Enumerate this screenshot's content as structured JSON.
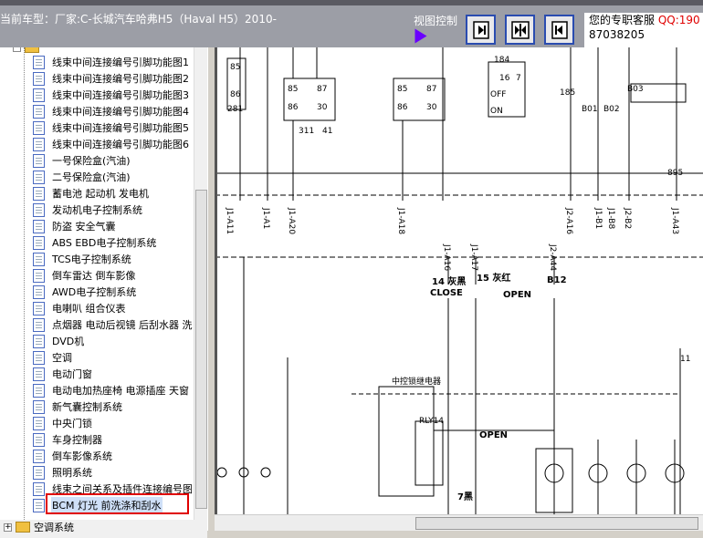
{
  "header": {
    "title": "当前车型：厂家:C-长城汽车哈弗H5（Haval H5）2010-",
    "view_control": "视图控制",
    "support_label": "您的专职客服",
    "qq_label": "QQ:190",
    "support_number": "87038205"
  },
  "tree": {
    "items": [
      {
        "label": "线束中间连接编号引脚功能图1"
      },
      {
        "label": "线束中间连接编号引脚功能图2"
      },
      {
        "label": "线束中间连接编号引脚功能图3"
      },
      {
        "label": "线束中间连接编号引脚功能图4"
      },
      {
        "label": "线束中间连接编号引脚功能图5"
      },
      {
        "label": "线束中间连接编号引脚功能图6"
      },
      {
        "label": "一号保险盒(汽油)"
      },
      {
        "label": "二号保险盒(汽油)"
      },
      {
        "label": "蓄电池 起动机 发电机"
      },
      {
        "label": "发动机电子控制系统"
      },
      {
        "label": "防盗 安全气囊"
      },
      {
        "label": "ABS EBD电子控制系统"
      },
      {
        "label": "TCS电子控制系统"
      },
      {
        "label": "倒车雷达 倒车影像"
      },
      {
        "label": "AWD电子控制系统"
      },
      {
        "label": "电喇叭 组合仪表"
      },
      {
        "label": "点烟器 电动后视镜 后刮水器 洗"
      },
      {
        "label": "DVD机"
      },
      {
        "label": "空调"
      },
      {
        "label": "电动门窗"
      },
      {
        "label": "电动电加热座椅 电源插座 天窗"
      },
      {
        "label": "新气囊控制系统"
      },
      {
        "label": "中央门锁"
      },
      {
        "label": "车身控制器"
      },
      {
        "label": "倒车影像系统"
      },
      {
        "label": "照明系统"
      },
      {
        "label": "线束之间关系及插件连接编号图"
      },
      {
        "label": "BCM 灯光 前洗涤和刮水"
      }
    ],
    "selected_index": 27,
    "bottom_folder": "空调系统"
  },
  "diagram": {
    "labels": {
      "relay1": "85",
      "relay1b": "86",
      "relay1c": "281",
      "r2_85": "85",
      "r2_87": "87",
      "r2_86": "86",
      "r2_30": "30",
      "r3_85": "85",
      "r3_87": "87",
      "r3_86": "86",
      "r3_30": "30",
      "w311": "311",
      "w41": "41",
      "sw_184": "184",
      "sw_16": "16",
      "sw_7": "7",
      "sw_off": "OFF",
      "sw_on": "ON",
      "sw_185": "185",
      "b01": "B01",
      "b02": "B02",
      "b03": "B03",
      "n895": "895",
      "c14": "14 灰黑",
      "close": "CLOSE",
      "c15": "15 灰红",
      "open": "OPEN",
      "b12": "B12",
      "central_lock": "中控锁继电器",
      "rly14": "RLY14",
      "open2": "OPEN",
      "n11": "11",
      "n7": "7黑",
      "j1a11": "J1-A11",
      "j1a1": "J1-A1",
      "j1a20": "J1-A20",
      "j1a18": "J1-A18",
      "j2a16": "J2-A16",
      "j1b1": "J1-B1",
      "j1b8": "J1-B8",
      "j2b2": "J2-B2",
      "j1a43": "J1-A43",
      "j1a16": "J1-A16",
      "j1a17": "J1-A17",
      "j2a44": "J2-A44"
    }
  }
}
